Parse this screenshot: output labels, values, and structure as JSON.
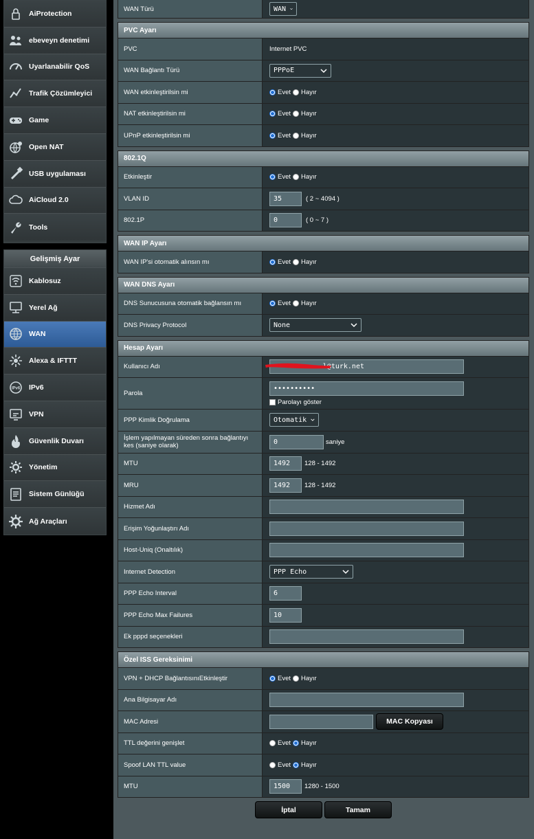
{
  "sidebar": {
    "general_items": [
      {
        "name": "aiprotection",
        "label": "AiProtection",
        "icon": "lock-shield-icon"
      },
      {
        "name": "parental",
        "label": "ebeveyn denetimi",
        "icon": "family-icon"
      },
      {
        "name": "qos",
        "label": "Uyarlanabilir QoS",
        "icon": "speedometer-icon"
      },
      {
        "name": "traffic",
        "label": "Trafik Çözümleyici",
        "icon": "chart-icon"
      },
      {
        "name": "game",
        "label": "Game",
        "icon": "gamepad-icon"
      },
      {
        "name": "open-nat",
        "label": "Open NAT",
        "icon": "globe-gear-icon"
      },
      {
        "name": "usb",
        "label": "USB uygulaması",
        "icon": "usb-icon"
      },
      {
        "name": "aicloud",
        "label": "AiCloud 2.0",
        "icon": "cloud-icon"
      },
      {
        "name": "tools",
        "label": "Tools",
        "icon": "wrench-icon"
      }
    ],
    "advanced_title": "Gelişmiş Ayar",
    "advanced_items": [
      {
        "name": "wireless",
        "label": "Kablosuz",
        "icon": "wifi-icon"
      },
      {
        "name": "lan",
        "label": "Yerel Ağ",
        "icon": "lan-icon"
      },
      {
        "name": "wan",
        "label": "WAN",
        "icon": "globe-icon",
        "active": true
      },
      {
        "name": "alexa",
        "label": "Alexa & IFTTT",
        "icon": "alexa-icon"
      },
      {
        "name": "ipv6",
        "label": "IPv6",
        "icon": "ipv6-icon"
      },
      {
        "name": "vpn",
        "label": "VPN",
        "icon": "vpn-icon"
      },
      {
        "name": "firewall",
        "label": "Güvenlik Duvarı",
        "icon": "firewall-icon"
      },
      {
        "name": "admin",
        "label": "Yönetim",
        "icon": "admin-gear-icon"
      },
      {
        "name": "syslog",
        "label": "Sistem Günlüğü",
        "icon": "log-icon"
      },
      {
        "name": "net-tools",
        "label": "Ağ Araçları",
        "icon": "network-tools-icon"
      }
    ]
  },
  "wan_type": {
    "label": "WAN Türü",
    "value": "WAN"
  },
  "pvc": {
    "title": "PVC Ayarı",
    "pvc_label": "PVC",
    "pvc_value": "Internet PVC",
    "conn_type_label": "WAN Bağlantı Türü",
    "conn_type_value": "PPPoE",
    "wan_enable_label": "WAN etkinleştirilsin mi",
    "nat_enable_label": "NAT etkinleştirilsin mi",
    "upnp_enable_label": "UPnP etkinleştirilsin mi"
  },
  "dot1q": {
    "title": "802.1Q",
    "enable_label": "Etkinleştir",
    "vlan_label": "VLAN ID",
    "vlan_value": "35",
    "vlan_hint": "( 2 ~ 4094 )",
    "p_label": "802.1P",
    "p_value": "0",
    "p_hint": "( 0 ~ 7 )"
  },
  "wan_ip": {
    "title": "WAN IP Ayarı",
    "auto_label": "WAN IP'si otomatik alınsın mı"
  },
  "wan_dns": {
    "title": "WAN DNS Ayarı",
    "auto_label": "DNS Sunucusuna otomatik bağlansın mı",
    "privacy_label": "DNS Privacy Protocol",
    "privacy_value": "None"
  },
  "account": {
    "title": "Hesap Ayarı",
    "user_label": "Kullanıcı Adı",
    "user_value": "l@turk.net",
    "pass_label": "Parola",
    "pass_value": "••••••••••",
    "show_pass_label": "Parolayı göster",
    "auth_label": "PPP Kimlik Doğrulama",
    "auth_value": "Otomatik",
    "idle_label": "İşlem yapılmayan süreden sonra bağlantıyı kes (saniye olarak)",
    "idle_value": "0",
    "idle_unit": "saniye",
    "mtu_label": "MTU",
    "mtu_value": "1492",
    "mtu_hint": "128 - 1492",
    "mru_label": "MRU",
    "mru_value": "1492",
    "mru_hint": "128 - 1492",
    "service_label": "Hizmet Adı",
    "ac_label": "Erişim Yoğunlaştırı Adı",
    "host_uniq_label": "Host-Uniq (Onaltılık)",
    "detect_label": "Internet Detection",
    "detect_value": "PPP Echo",
    "echo_interval_label": "PPP Echo Interval",
    "echo_interval_value": "6",
    "echo_fail_label": "PPP Echo Max Failures",
    "echo_fail_value": "10",
    "pppd_label": "Ek pppd seçenekleri"
  },
  "isp": {
    "title": "Özel ISS Gereksinimi",
    "vpn_dhcp_label": "VPN + DHCP BağlantısınıEtkinleştir",
    "hostname_label": "Ana Bilgisayar Adı",
    "mac_label": "MAC Adresi",
    "mac_clone_label": "MAC Kopyası",
    "ttl_label": "TTL değerini genişlet",
    "spoof_label": "Spoof LAN TTL value",
    "mtu_label": "MTU",
    "mtu_value": "1500",
    "mtu_hint": "1280 - 1500"
  },
  "radio": {
    "yes": "Evet",
    "no": "Hayır"
  },
  "buttons": {
    "cancel": "İptal",
    "ok": "Tamam"
  },
  "colors": {
    "active_menu": "#2d5b96",
    "radio_selected": "#1f6fd6",
    "redaction": "#e0141e"
  }
}
